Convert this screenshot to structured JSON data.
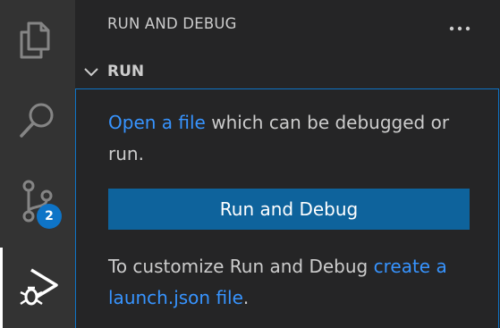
{
  "activity_bar": {
    "items": [
      {
        "name": "explorer",
        "icon": "files-icon",
        "active": false
      },
      {
        "name": "search",
        "icon": "search-icon",
        "active": false
      },
      {
        "name": "source-control",
        "icon": "source-control-icon",
        "active": false,
        "badge": "2"
      },
      {
        "name": "run-and-debug",
        "icon": "run-debug-icon",
        "active": true
      }
    ],
    "badge_color": "#0e74c7"
  },
  "sidebar": {
    "title": "RUN AND DEBUG",
    "more_actions_icon": "ellipsis-icon",
    "section": {
      "title": "RUN",
      "expanded": true,
      "welcome": {
        "line1_link": "Open a file",
        "line1_text": " which can be debugged or run.",
        "button_label": "Run and Debug",
        "line2_text": "To customize Run and Debug ",
        "line2_link": "create a launch.json file",
        "line2_end": "."
      }
    }
  },
  "colors": {
    "link": "#3794ff",
    "button": "#0e639c",
    "focus_border": "#0e74c7",
    "activity_bar": "#333333",
    "sidebar": "#252526"
  }
}
